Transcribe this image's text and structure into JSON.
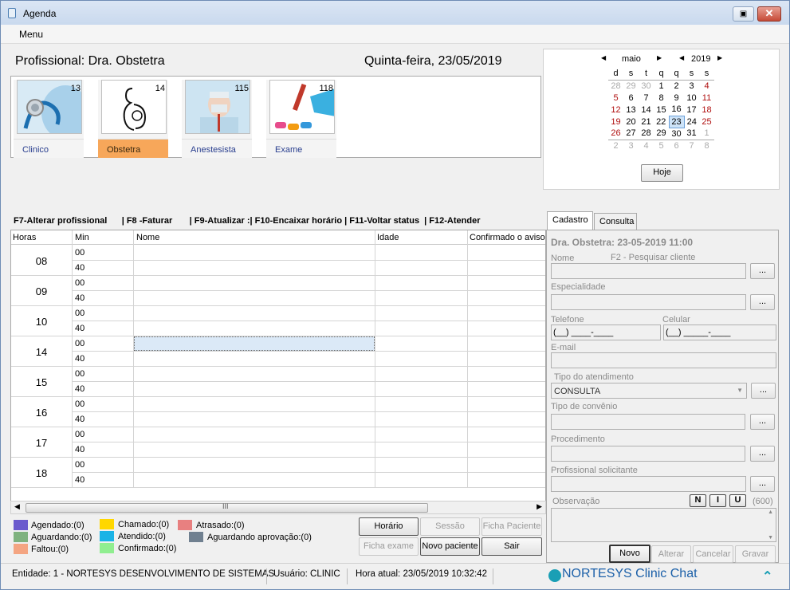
{
  "window": {
    "title": "Agenda"
  },
  "menu": {
    "label": "Menu"
  },
  "header": {
    "professional": "Profissional: Dra. Obstetra",
    "date": "Quinta-feira, 23/05/2019"
  },
  "professionals": [
    {
      "label": "Clinico",
      "count": "13"
    },
    {
      "label": "Obstetra",
      "count": "14"
    },
    {
      "label": "Anestesista",
      "count": "115"
    },
    {
      "label": "Exame",
      "count": "118"
    }
  ],
  "calendar": {
    "month": "maio",
    "year": "2019",
    "weekdays": [
      "d",
      "s",
      "t",
      "q",
      "q",
      "s",
      "s"
    ],
    "weeks": [
      [
        "28",
        "29",
        "30",
        "1",
        "2",
        "3",
        "4"
      ],
      [
        "5",
        "6",
        "7",
        "8",
        "9",
        "10",
        "11"
      ],
      [
        "12",
        "13",
        "14",
        "15",
        "16",
        "17",
        "18"
      ],
      [
        "19",
        "20",
        "21",
        "22",
        "23",
        "24",
        "25"
      ],
      [
        "26",
        "27",
        "28",
        "29",
        "30",
        "31",
        "1"
      ],
      [
        "2",
        "3",
        "4",
        "5",
        "6",
        "7",
        "8"
      ]
    ],
    "today_button": "Hoje"
  },
  "fkeys": "F7-Alterar profissional      | F8 -Faturar       | F9-Atualizar :| F10-Encaixar horário | F11-Voltar status  | F12-Atender",
  "grid": {
    "columns": [
      "Horas",
      "Min",
      "Nome",
      "Idade",
      "Confirmado o aviso?"
    ],
    "hours": [
      "08",
      "09",
      "10",
      "14",
      "15",
      "16",
      "17",
      "18"
    ],
    "minutes": [
      "00",
      "40"
    ]
  },
  "legend": [
    {
      "label": "Agendado:(0)",
      "color": "#6a5acd"
    },
    {
      "label": "Aguardando:(0)",
      "color": "#7fb27f"
    },
    {
      "label": "Faltou:(0)",
      "color": "#f4a582"
    },
    {
      "label": "Chamado:(0)",
      "color": "#ffd700"
    },
    {
      "label": "Atendido:(0)",
      "color": "#1ab3e6"
    },
    {
      "label": "Confirmado:(0)",
      "color": "#90ee90"
    },
    {
      "label": "Atrasado:(0)",
      "color": "#e88080"
    },
    {
      "label": "Aguardando aprovação:(0)",
      "color": "#708090"
    }
  ],
  "actions": {
    "horario": "Horário",
    "sessao": "Sessão",
    "ficha_paciente": "Ficha Paciente",
    "ficha_exame": "Ficha exame",
    "novo_paciente": "Novo paciente",
    "sair": "Sair"
  },
  "tabs": {
    "cadastro": "Cadastro",
    "consulta": "Consulta"
  },
  "form": {
    "title": "Dra. Obstetra: 23-05-2019 11:00",
    "nome": "Nome",
    "nome_hint": "F2 - Pesquisar cliente",
    "especialidade": "Especialidade",
    "telefone": "Telefone",
    "celular": "Celular",
    "telefone_value": "(__) ____-____",
    "celular_value": "(__) _____-____",
    "email": "E-mail",
    "tipo_atendimento": "Tipo do atendimento",
    "tipo_atendimento_value": "CONSULTA",
    "tipo_convenio": "Tipo de convênio",
    "procedimento": "Procedimento",
    "profissional_solicitante": "Profissional solicitante",
    "observacao": "Observação",
    "obs_counter": "(600)",
    "fmt_n": "N",
    "fmt_i": "I",
    "fmt_u": "U",
    "dots": "...",
    "novo": "Novo",
    "alterar": "Alterar",
    "cancelar": "Cancelar",
    "gravar": "Gravar"
  },
  "status": {
    "entidade": "Entidade: 1 - NORTESYS DESENVOLVIMENTO DE SISTEMAS",
    "usuario": "Usuário: CLINIC",
    "hora": "Hora atual: 23/05/2019 10:32:42",
    "chat": "NORTESYS Clinic Chat"
  }
}
